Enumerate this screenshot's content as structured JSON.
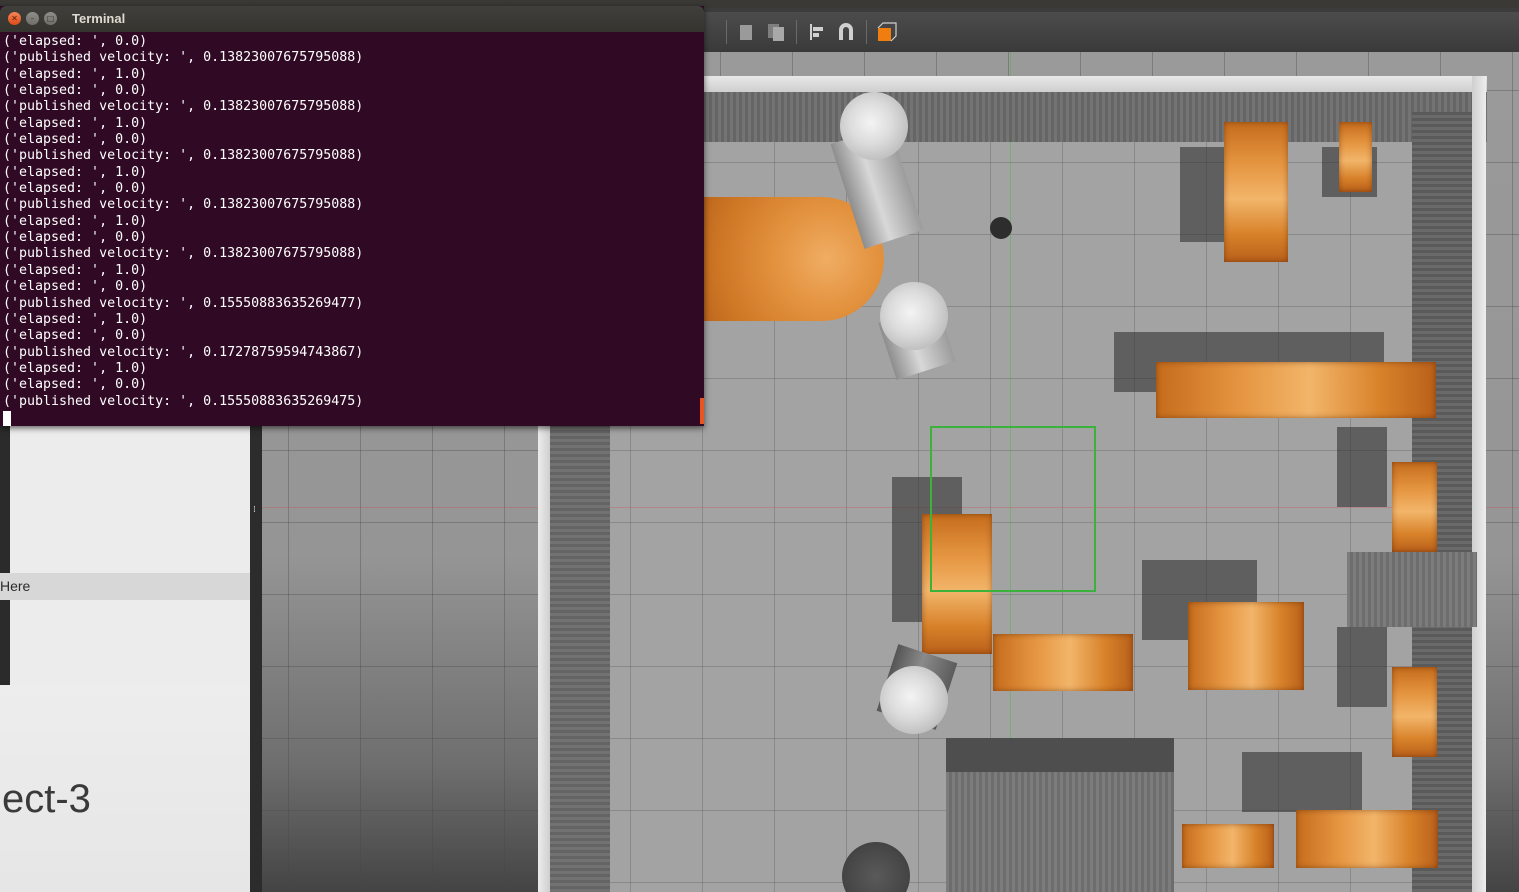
{
  "terminal": {
    "title": "Terminal",
    "lines": [
      "('elapsed: ', 0.0)",
      "('published velocity: ', 0.13823007675795088)",
      "('elapsed: ', 1.0)",
      "('elapsed: ', 0.0)",
      "('published velocity: ', 0.13823007675795088)",
      "('elapsed: ', 1.0)",
      "('elapsed: ', 0.0)",
      "('published velocity: ', 0.13823007675795088)",
      "('elapsed: ', 1.0)",
      "('elapsed: ', 0.0)",
      "('published velocity: ', 0.13823007675795088)",
      "('elapsed: ', 1.0)",
      "('elapsed: ', 0.0)",
      "('published velocity: ', 0.13823007675795088)",
      "('elapsed: ', 1.0)",
      "('elapsed: ', 0.0)",
      "('published velocity: ', 0.15550883635269477)",
      "('elapsed: ', 1.0)",
      "('elapsed: ', 0.0)",
      "('published velocity: ', 0.17278759594743867)",
      "('elapsed: ', 1.0)",
      "('elapsed: ', 0.0)",
      "('published velocity: ', 0.15550883635269475)"
    ]
  },
  "left_panel": {
    "highlight_text": "Here",
    "big_text": "ect-3"
  },
  "toolbar": {
    "icons": [
      "copy-icon",
      "paste-icon",
      "align-icon",
      "snap-icon",
      "view-angle-icon"
    ]
  },
  "colors": {
    "terminal_bg": "#300a24",
    "wood": "#e08a35",
    "selection_box": "#3bb23b"
  }
}
